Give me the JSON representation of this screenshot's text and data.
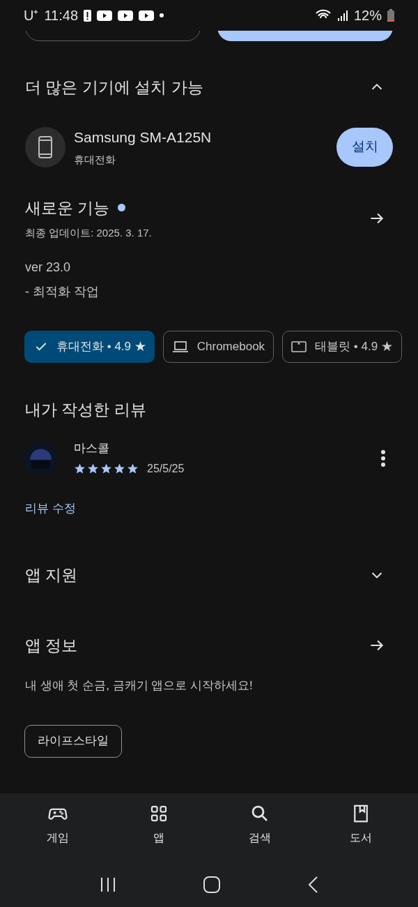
{
  "status_bar": {
    "carrier": "U⁺",
    "time": "11:48",
    "battery": "12%"
  },
  "install_section": {
    "title": "더 많은 기기에 설치 가능",
    "expanded": true,
    "device": {
      "name": "Samsung SM-A125N",
      "type": "휴대전화",
      "button": "설치"
    }
  },
  "whats_new": {
    "title": "새로운 기능",
    "updated": "최종 업데이트: 2025. 3. 17.",
    "version": "ver 23.0",
    "notes": "- 최적화 작업"
  },
  "device_chips": [
    {
      "kind": "phone",
      "label": "휴대전화 • 4.9 ★",
      "selected": true
    },
    {
      "kind": "laptop",
      "label": "Chromebook",
      "selected": false
    },
    {
      "kind": "tablet",
      "label": "태블릿 • 4.9 ★",
      "selected": false
    }
  ],
  "my_review": {
    "title": "내가 작성한 리뷰",
    "author": "마스콜",
    "stars": 5,
    "date": "25/5/25",
    "edit_link": "리뷰 수정"
  },
  "app_support": {
    "title": "앱 지원",
    "expanded": false
  },
  "app_info": {
    "title": "앱 정보",
    "description": "내 생애 첫 순금, 금캐기 앱으로 시작하세요!",
    "tag": "라이프스타일"
  },
  "bottom_nav": [
    {
      "kind": "games",
      "label": "게임"
    },
    {
      "kind": "apps",
      "label": "앱"
    },
    {
      "kind": "search",
      "label": "검색"
    },
    {
      "kind": "books",
      "label": "도서"
    }
  ]
}
